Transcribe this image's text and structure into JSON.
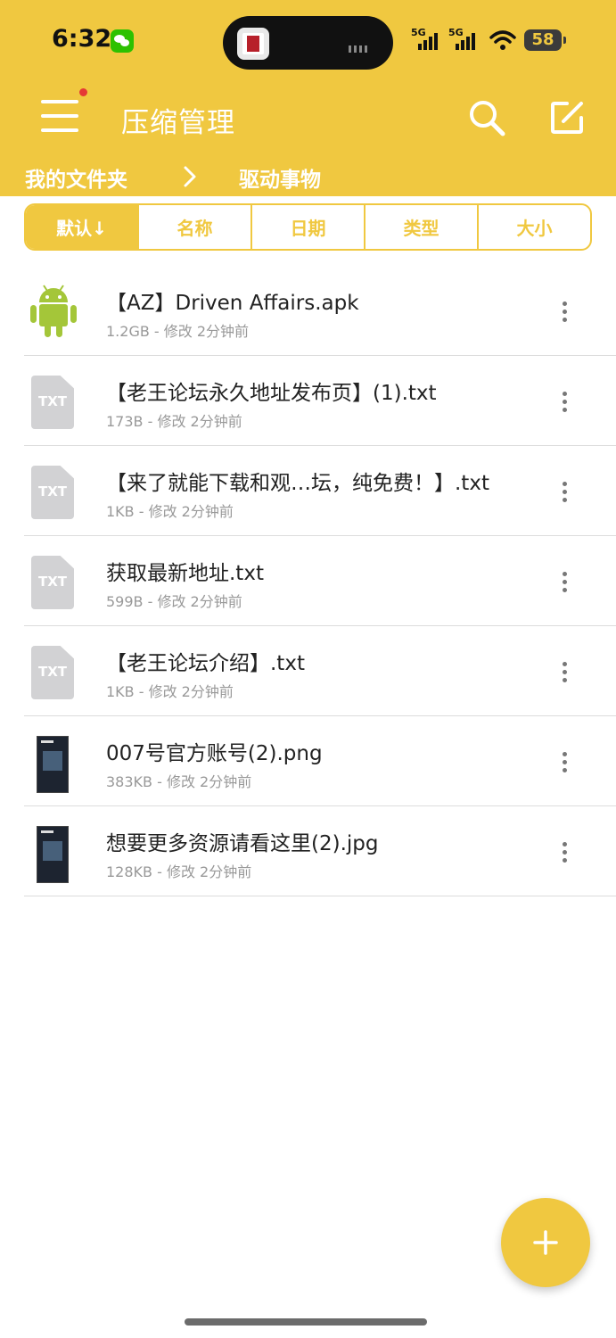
{
  "status_bar": {
    "time": "6:32",
    "network_1": "5G",
    "network_2": "5G",
    "battery": "58"
  },
  "toolbar": {
    "title": "压缩管理"
  },
  "breadcrumb": {
    "root": "我的文件夹",
    "current": "驱动事物"
  },
  "sort_tabs": [
    {
      "label": "默认↓",
      "active": true
    },
    {
      "label": "名称",
      "active": false
    },
    {
      "label": "日期",
      "active": false
    },
    {
      "label": "类型",
      "active": false
    },
    {
      "label": "大小",
      "active": false
    }
  ],
  "files": [
    {
      "name": "【AZ】Driven Affairs.apk",
      "meta": "1.2GB - 修改 2分钟前",
      "icon": "android-icon"
    },
    {
      "name": "【老王论坛永久地址发布页】(1).txt",
      "meta": "173B - 修改 2分钟前",
      "icon": "txt-file-icon",
      "icon_label": "TXT"
    },
    {
      "name": "【来了就能下载和观…坛，纯免费！】.txt",
      "meta": "1KB - 修改 2分钟前",
      "icon": "txt-file-icon",
      "icon_label": "TXT"
    },
    {
      "name": "获取最新地址.txt",
      "meta": "599B - 修改 2分钟前",
      "icon": "txt-file-icon",
      "icon_label": "TXT"
    },
    {
      "name": "【老王论坛介绍】.txt",
      "meta": "1KB - 修改 2分钟前",
      "icon": "txt-file-icon",
      "icon_label": "TXT"
    },
    {
      "name": "007号官方账号(2).png",
      "meta": "383KB - 修改 2分钟前",
      "icon": "image-thumbnail"
    },
    {
      "name": "想要更多资源请看这里(2).jpg",
      "meta": "128KB - 修改 2分钟前",
      "icon": "image-thumbnail"
    }
  ],
  "colors": {
    "accent": "#f0c840",
    "notification": "#e53935"
  }
}
